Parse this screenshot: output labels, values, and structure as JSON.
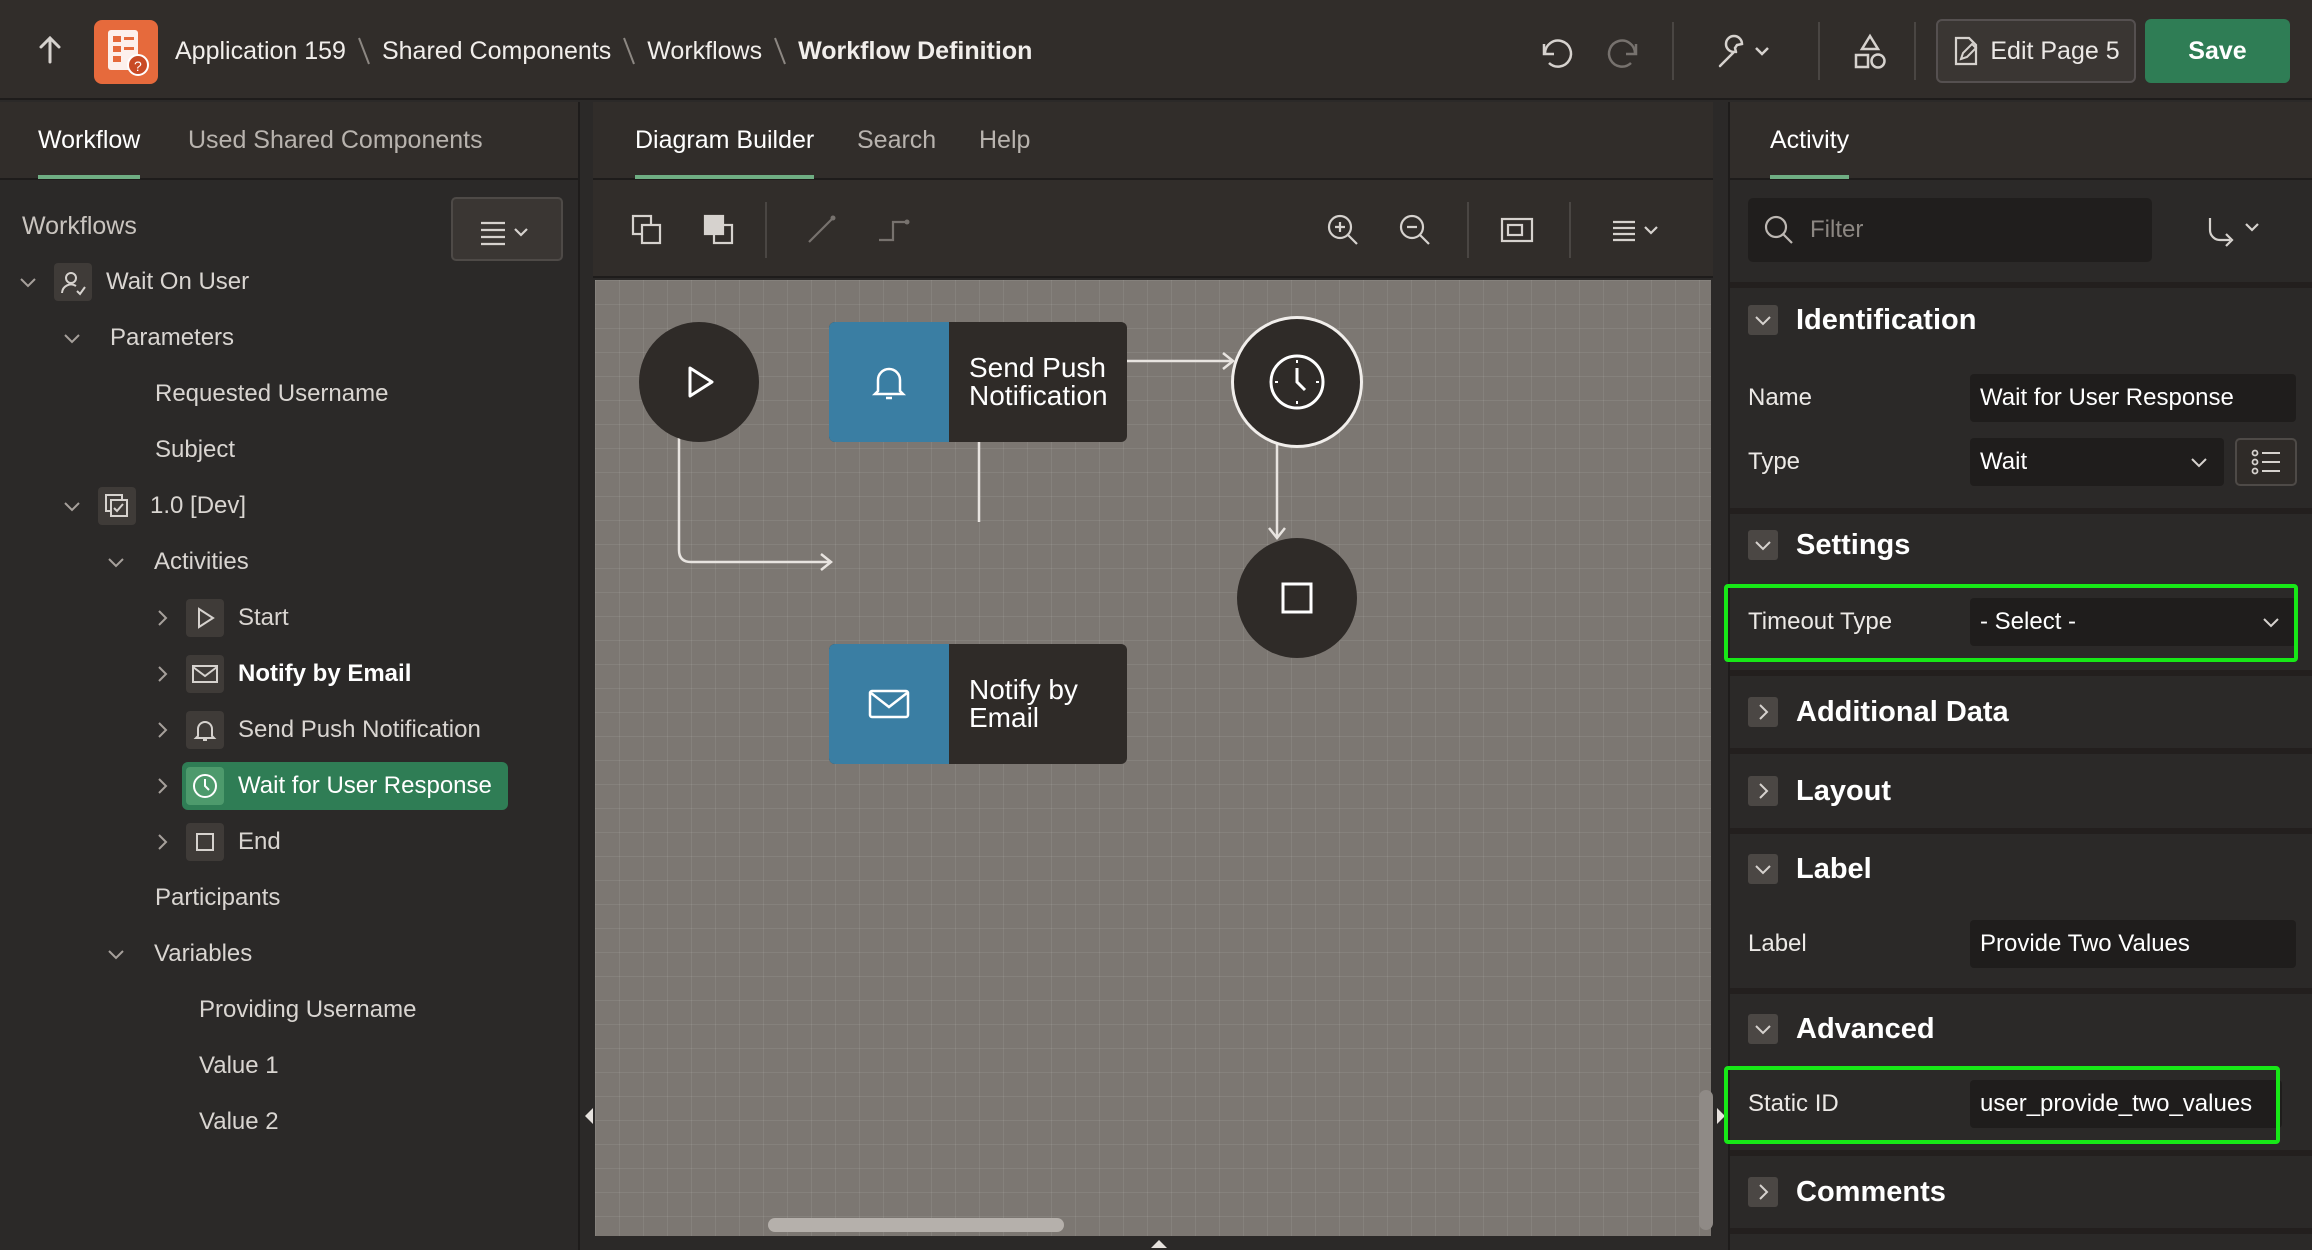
{
  "header": {
    "breadcrumbs": [
      "Application 159",
      "Shared Components",
      "Workflows",
      "Workflow Definition"
    ],
    "edit_page_label": "Edit Page 5",
    "save_label": "Save"
  },
  "left_panel": {
    "tabs": [
      "Workflow",
      "Used Shared Components"
    ],
    "active_tab": "Workflow",
    "heading": "Workflows",
    "tree": {
      "workflow": "Wait On User",
      "parameters_label": "Parameters",
      "parameters": [
        "Requested Username",
        "Subject"
      ],
      "version": "1.0 [Dev]",
      "activities_label": "Activities",
      "activities": [
        "Start",
        "Notify by Email",
        "Send Push Notification",
        "Wait for User Response",
        "End"
      ],
      "selected_activity": "Wait for User Response",
      "bold_activity": "Notify by Email",
      "participants_label": "Participants",
      "variables_label": "Variables",
      "variables": [
        "Providing Username",
        "Value 1",
        "Value 2"
      ]
    }
  },
  "center_panel": {
    "tabs": [
      "Diagram Builder",
      "Search",
      "Help"
    ],
    "active_tab": "Diagram Builder",
    "diagram": {
      "nodes": {
        "push": "Send Push Notification",
        "email": "Notify by Email"
      }
    }
  },
  "right_panel": {
    "tab": "Activity",
    "filter_placeholder": "Filter",
    "sections": {
      "identification": "Identification",
      "settings": "Settings",
      "additional_data": "Additional Data",
      "layout": "Layout",
      "label": "Label",
      "advanced": "Advanced",
      "comments": "Comments"
    },
    "properties": {
      "name_label": "Name",
      "name_value": "Wait for User Response",
      "type_label": "Type",
      "type_value": "Wait",
      "timeout_type_label": "Timeout Type",
      "timeout_type_value": "- Select -",
      "label_label": "Label",
      "label_value": "Provide Two Values",
      "static_id_label": "Static ID",
      "static_id_value": "user_provide_two_values"
    }
  },
  "colors": {
    "accent_green": "#2f7d55",
    "node_blue": "#3a7ea3",
    "highlight": "#17e817",
    "canvas": "#7c7772"
  }
}
